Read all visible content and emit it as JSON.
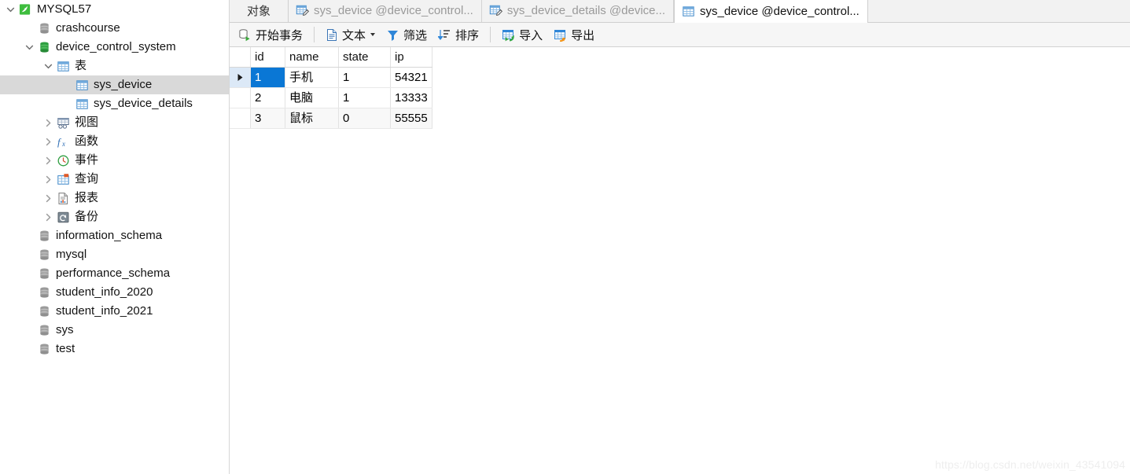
{
  "colors": {
    "accent_blue": "#0a77d5",
    "header_highlight": "#dce9f7",
    "tree_selection": "#d9d9d9",
    "green_db": "#2f9e41",
    "grey_db": "#8c8c8c",
    "toolbar_bg": "#f6f6f6",
    "tab_bg": "#f2f2f2",
    "watermark": "#eeeeee"
  },
  "sidebar": {
    "items": [
      {
        "label": "MYSQL57",
        "icon": "mysql-dolphin-icon",
        "level": 0,
        "twisty": "expanded",
        "selected": false
      },
      {
        "label": "crashcourse",
        "icon": "database-grey-icon",
        "level": 1,
        "twisty": "none",
        "selected": false
      },
      {
        "label": "device_control_system",
        "icon": "database-green-icon",
        "level": 1,
        "twisty": "expanded",
        "selected": false
      },
      {
        "label": "表",
        "icon": "table-folder-icon",
        "level": 2,
        "twisty": "expanded",
        "selected": false
      },
      {
        "label": "sys_device",
        "icon": "table-icon",
        "level": 3,
        "twisty": "none",
        "selected": true
      },
      {
        "label": "sys_device_details",
        "icon": "table-icon",
        "level": 3,
        "twisty": "none",
        "selected": false
      },
      {
        "label": "视图",
        "icon": "view-icon",
        "level": 2,
        "twisty": "collapsed",
        "selected": false
      },
      {
        "label": "函数",
        "icon": "function-fx-icon",
        "level": 2,
        "twisty": "collapsed",
        "selected": false
      },
      {
        "label": "事件",
        "icon": "event-clock-icon",
        "level": 2,
        "twisty": "collapsed",
        "selected": false
      },
      {
        "label": "查询",
        "icon": "query-icon",
        "level": 2,
        "twisty": "collapsed",
        "selected": false
      },
      {
        "label": "报表",
        "icon": "report-icon",
        "level": 2,
        "twisty": "collapsed",
        "selected": false
      },
      {
        "label": "备份",
        "icon": "backup-icon",
        "level": 2,
        "twisty": "collapsed",
        "selected": false
      },
      {
        "label": "information_schema",
        "icon": "database-grey-icon",
        "level": 1,
        "twisty": "none",
        "selected": false
      },
      {
        "label": "mysql",
        "icon": "database-grey-icon",
        "level": 1,
        "twisty": "none",
        "selected": false
      },
      {
        "label": "performance_schema",
        "icon": "database-grey-icon",
        "level": 1,
        "twisty": "none",
        "selected": false
      },
      {
        "label": "student_info_2020",
        "icon": "database-grey-icon",
        "level": 1,
        "twisty": "none",
        "selected": false
      },
      {
        "label": "student_info_2021",
        "icon": "database-grey-icon",
        "level": 1,
        "twisty": "none",
        "selected": false
      },
      {
        "label": "sys",
        "icon": "database-grey-icon",
        "level": 1,
        "twisty": "none",
        "selected": false
      },
      {
        "label": "test",
        "icon": "database-grey-icon",
        "level": 1,
        "twisty": "none",
        "selected": false
      }
    ]
  },
  "tabstrip": {
    "objects_label": "对象",
    "tabs": [
      {
        "label": "sys_device @device_control...",
        "icon": "table-edit-icon",
        "active": false
      },
      {
        "label": "sys_device_details @device...",
        "icon": "table-edit-icon",
        "active": false
      },
      {
        "label": "sys_device @device_control...",
        "icon": "table-icon",
        "active": true
      }
    ]
  },
  "toolbar": {
    "begin_transaction": "开始事务",
    "text": "文本",
    "filter": "筛选",
    "sort": "排序",
    "import": "导入",
    "export": "导出"
  },
  "grid": {
    "columns": [
      "id",
      "name",
      "state",
      "ip"
    ],
    "selected_column": "id",
    "selected_row_index": 0,
    "rows": [
      {
        "id": "1",
        "name": "手机",
        "state": "1",
        "ip": "54321"
      },
      {
        "id": "2",
        "name": "电脑",
        "state": "1",
        "ip": "13333"
      },
      {
        "id": "3",
        "name": "鼠标",
        "state": "0",
        "ip": "55555"
      }
    ]
  },
  "watermark": {
    "text": "https://blog.csdn.net/weixin_43541094"
  }
}
